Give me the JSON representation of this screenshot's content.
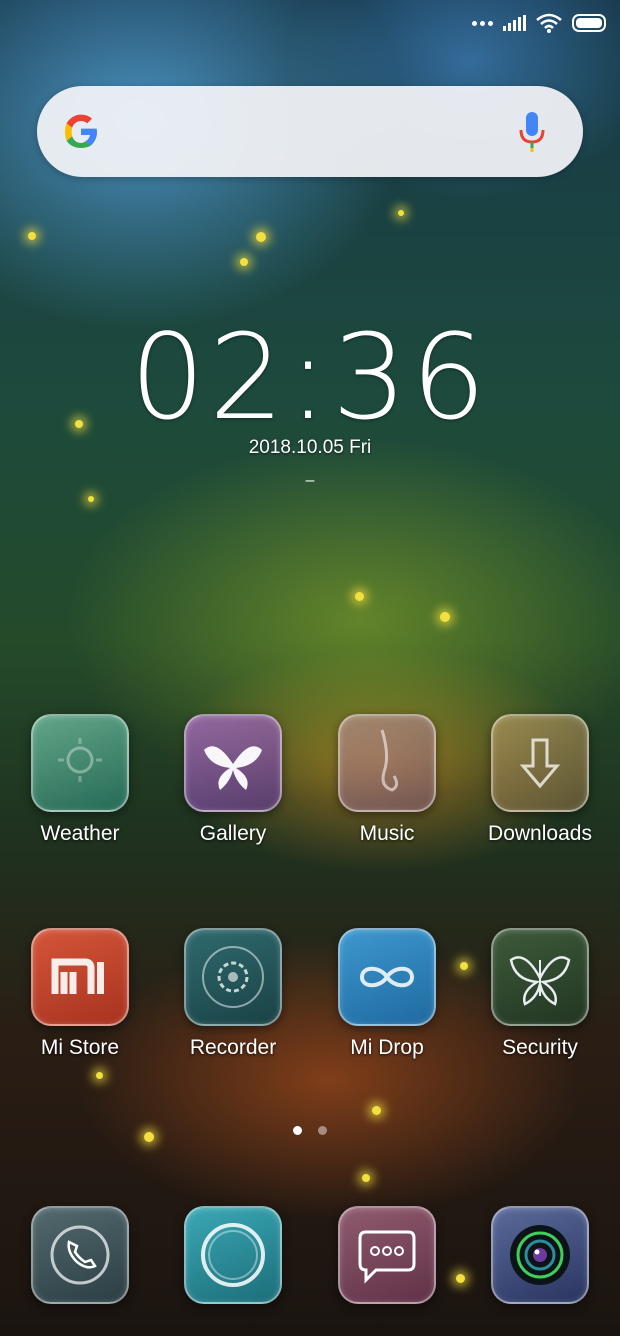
{
  "status_bar": {
    "icons": [
      "dots-icon",
      "signal-icon",
      "wifi-icon",
      "battery-icon"
    ]
  },
  "search_bar": {
    "logo": "google-icon",
    "mic": "microphone-icon"
  },
  "clock": {
    "time": "02:36",
    "date": "2018.10.05 Fri",
    "sub": "–"
  },
  "apps_row1": [
    {
      "label": "Weather",
      "icon": "weather-icon"
    },
    {
      "label": "Gallery",
      "icon": "butterfly-gallery-icon"
    },
    {
      "label": "Music",
      "icon": "music-icon"
    },
    {
      "label": "Downloads",
      "icon": "download-arrow-icon"
    }
  ],
  "apps_row2": [
    {
      "label": "Mi Store",
      "icon": "mi-logo-icon"
    },
    {
      "label": "Recorder",
      "icon": "recorder-icon"
    },
    {
      "label": "Mi Drop",
      "icon": "infinity-icon"
    },
    {
      "label": "Security",
      "icon": "butterfly-security-icon"
    }
  ],
  "dock": [
    {
      "icon": "phone-icon"
    },
    {
      "icon": "browser-ring-icon"
    },
    {
      "icon": "message-icon"
    },
    {
      "icon": "camera-icon"
    }
  ],
  "pager": {
    "pages": 2,
    "active": 0
  }
}
